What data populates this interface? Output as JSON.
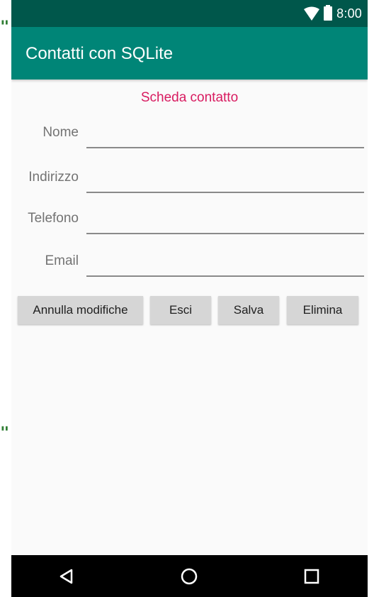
{
  "status_bar": {
    "time": "8:00",
    "icons": [
      "wifi-icon",
      "battery-icon"
    ]
  },
  "app_bar": {
    "title": "Contatti con SQLite",
    "color": "#008577",
    "status_color": "#00574b"
  },
  "form": {
    "title": "Scheda contatto",
    "title_color": "#d81b60",
    "fields": [
      {
        "label": "Nome",
        "value": ""
      },
      {
        "label": "Indirizzo",
        "value": ""
      },
      {
        "label": "Telefono",
        "value": ""
      },
      {
        "label": "Email",
        "value": ""
      }
    ]
  },
  "buttons": {
    "annulla": "Annulla modifiche",
    "esci": "Esci",
    "salva": "Salva",
    "elimina": "Elimina"
  },
  "nav_bar": {
    "icons": [
      "back-icon",
      "home-icon",
      "recent-apps-icon"
    ]
  }
}
